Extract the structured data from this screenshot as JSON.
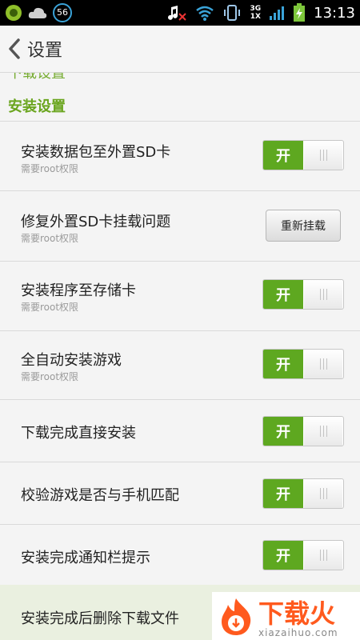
{
  "status_bar": {
    "badge_number": "56",
    "network_top": "3G",
    "network_bottom": "1X",
    "time": "13:13"
  },
  "title_bar": {
    "title": "设置"
  },
  "sections": {
    "clipped_header": "下载设置",
    "install_header": "安装设置"
  },
  "rows": [
    {
      "label": "安装数据包至外置SD卡",
      "sub": "需要root权限",
      "control": "toggle",
      "toggle_on": "开"
    },
    {
      "label": "修复外置SD卡挂载问题",
      "sub": "需要root权限",
      "control": "button",
      "button_label": "重新挂载"
    },
    {
      "label": "安装程序至存储卡",
      "sub": "需要root权限",
      "control": "toggle",
      "toggle_on": "开"
    },
    {
      "label": "全自动安装游戏",
      "sub": "需要root权限",
      "control": "toggle",
      "toggle_on": "开"
    },
    {
      "label": "下载完成直接安装",
      "control": "toggle",
      "toggle_on": "开"
    },
    {
      "label": "校验游戏是否与手机匹配",
      "control": "toggle",
      "toggle_on": "开"
    },
    {
      "label": "安装完成通知栏提示",
      "control": "toggle",
      "toggle_on": "开"
    },
    {
      "label": "安装完成后删除下载文件"
    }
  ],
  "watermark": {
    "brand": "下载火",
    "url": "xiazaihuo.com"
  },
  "colors": {
    "accent_green": "#5ea820",
    "header_green": "#6aa51e"
  }
}
